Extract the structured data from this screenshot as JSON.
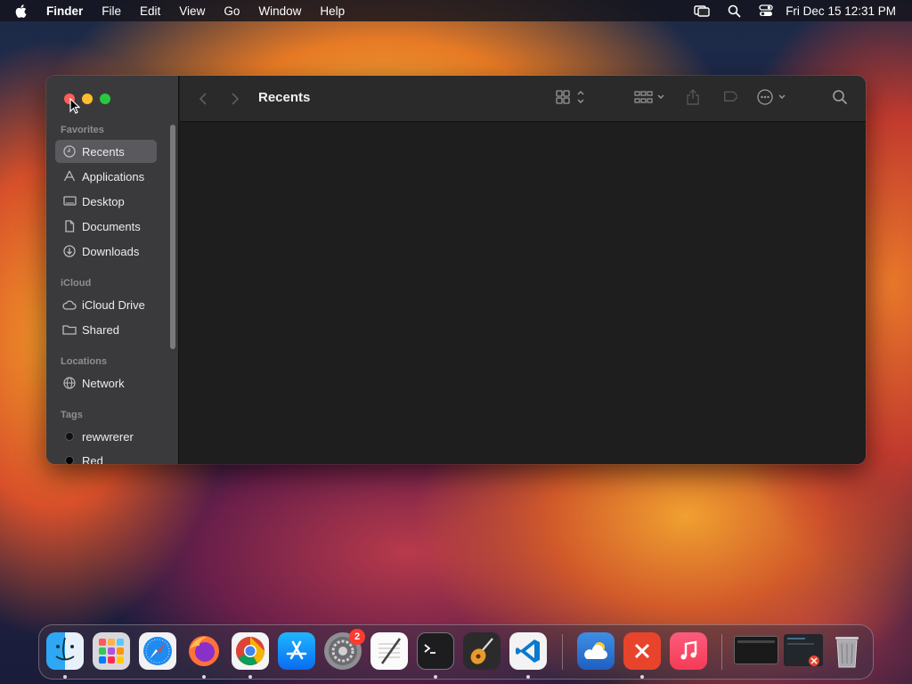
{
  "menubar": {
    "app_name": "Finder",
    "menus": [
      "File",
      "Edit",
      "View",
      "Go",
      "Window",
      "Help"
    ],
    "clock": "Fri Dec 15  12:31 PM"
  },
  "window": {
    "title": "Recents",
    "sidebar": {
      "favorites_header": "Favorites",
      "favorites": [
        {
          "label": "Recents",
          "icon": "clock-icon"
        },
        {
          "label": "Applications",
          "icon": "applications-icon"
        },
        {
          "label": "Desktop",
          "icon": "desktop-icon"
        },
        {
          "label": "Documents",
          "icon": "document-icon"
        },
        {
          "label": "Downloads",
          "icon": "download-icon"
        }
      ],
      "icloud_header": "iCloud",
      "icloud": [
        {
          "label": "iCloud Drive",
          "icon": "cloud-icon"
        },
        {
          "label": "Shared",
          "icon": "shared-folder-icon"
        }
      ],
      "locations_header": "Locations",
      "locations": [
        {
          "label": "Network",
          "icon": "globe-icon"
        }
      ],
      "tags_header": "Tags",
      "tags": [
        {
          "label": "rewwrerer",
          "icon": "tag-dot-icon"
        },
        {
          "label": "Red",
          "icon": "tag-dot-icon"
        }
      ]
    }
  },
  "dock": {
    "items": [
      {
        "name": "finder",
        "running": true
      },
      {
        "name": "launchpad",
        "running": false
      },
      {
        "name": "safari",
        "running": false
      },
      {
        "name": "firefox",
        "running": true
      },
      {
        "name": "chrome",
        "running": true
      },
      {
        "name": "app-store",
        "running": false
      },
      {
        "name": "system-settings",
        "running": false,
        "badge": "2"
      },
      {
        "name": "textedit",
        "running": false
      },
      {
        "name": "terminal",
        "running": true
      },
      {
        "name": "garageband",
        "running": false
      },
      {
        "name": "vscode",
        "running": true
      },
      {
        "name": "weather",
        "running": false
      },
      {
        "name": "remote-desktop",
        "running": true
      },
      {
        "name": "music",
        "running": false
      },
      {
        "name": "minimized-window-1",
        "running": false
      },
      {
        "name": "minimized-window-2",
        "running": false
      },
      {
        "name": "trash",
        "running": false
      }
    ],
    "settings_badge": "2"
  }
}
